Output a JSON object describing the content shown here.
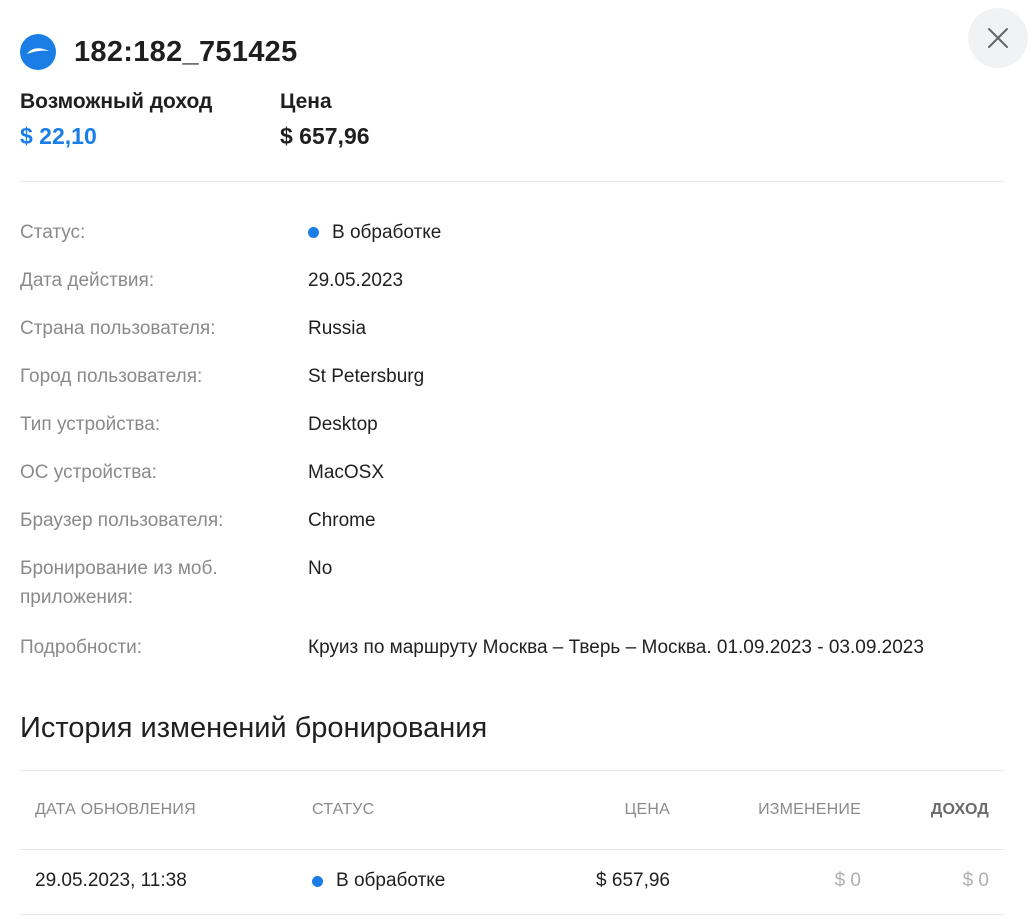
{
  "header": {
    "order_id": "182:182_751425",
    "logo_icon": "wave-logo-icon",
    "close_icon": "close-icon"
  },
  "summary": {
    "income_label": "Возможный доход",
    "income_value": "$ 22,10",
    "price_label": "Цена",
    "price_value": "$ 657,96"
  },
  "details": [
    {
      "label": "Статус:",
      "value": "В обработке",
      "dot": true
    },
    {
      "label": "Дата действия:",
      "value": "29.05.2023"
    },
    {
      "label": "Страна пользователя:",
      "value": "Russia"
    },
    {
      "label": "Город пользователя:",
      "value": "St Petersburg"
    },
    {
      "label": "Тип устройства:",
      "value": "Desktop"
    },
    {
      "label": "ОС устройства:",
      "value": "MacOSX"
    },
    {
      "label": "Браузер пользователя:",
      "value": "Chrome"
    },
    {
      "label": "Бронирование из моб. приложения:",
      "value": "No"
    },
    {
      "label": "Подробности:",
      "value": "Круиз по маршруту Москва – Тверь – Москва. 01.09.2023 - 03.09.2023"
    }
  ],
  "history": {
    "title": "История изменений бронирования",
    "columns": {
      "date": "ДАТА ОБНОВЛЕНИЯ",
      "status": "СТАТУС",
      "price": "ЦЕНА",
      "change": "ИЗМЕНЕНИЕ",
      "income": "ДОХОД"
    },
    "rows": [
      {
        "date": "29.05.2023, 11:38",
        "status": "В обработке",
        "price": "$ 657,96",
        "change": "$ 0",
        "income": "$ 0"
      }
    ]
  },
  "colors": {
    "accent": "#1a7ee6",
    "muted_text": "#8a8a8a",
    "zero_text": "#b0b0b0"
  }
}
